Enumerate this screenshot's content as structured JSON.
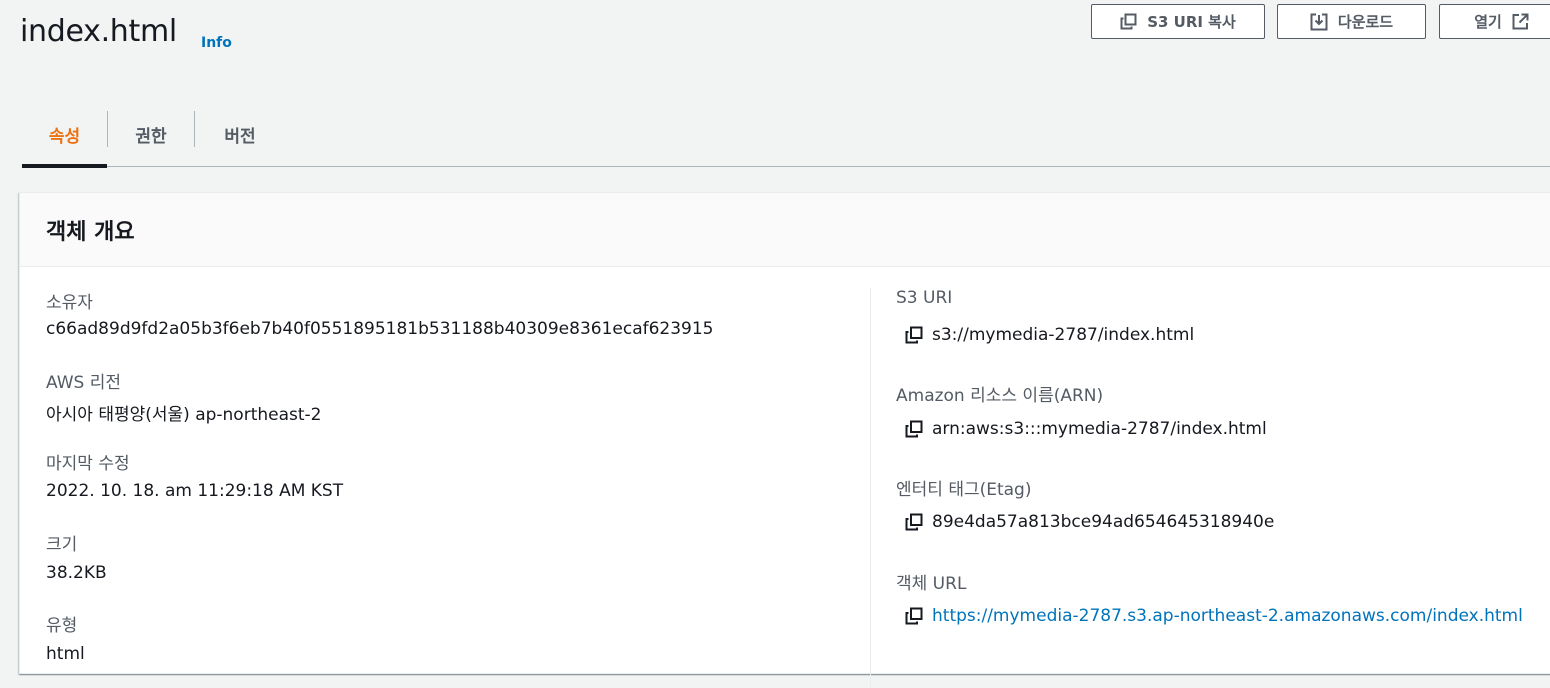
{
  "header": {
    "title": "index.html",
    "info_label": "Info",
    "buttons": {
      "copy_uri": "S3 URI 복사",
      "download": "다운로드",
      "open": "열기"
    }
  },
  "tabs": [
    {
      "label": "속성",
      "active": true
    },
    {
      "label": "권한",
      "active": false
    },
    {
      "label": "버전",
      "active": false
    }
  ],
  "overview": {
    "title": "객체 개요",
    "left": {
      "owner_label": "소유자",
      "owner_value": "c66ad89d9fd2a05b3f6eb7b40f0551895181b531188b40309e8361ecaf623915",
      "region_label": "AWS 리전",
      "region_value": "아시아 태평양(서울) ap-northeast-2",
      "modified_label": "마지막 수정",
      "modified_value": "2022. 10. 18. am 11:29:18 AM KST",
      "size_label": "크기",
      "size_value": "38.2KB",
      "type_label": "유형",
      "type_value": "html"
    },
    "right": {
      "s3uri_label": "S3 URI",
      "s3uri_value": "s3://mymedia-2787/index.html",
      "arn_label": "Amazon 리소스 이름(ARN)",
      "arn_value": "arn:aws:s3:::mymedia-2787/index.html",
      "etag_label": "엔터티 태그(Etag)",
      "etag_value": "89e4da57a813bce94ad654645318940e",
      "url_label": "객체 URL",
      "url_value": "https://mymedia-2787.s3.ap-northeast-2.amazonaws.com/index.html"
    }
  },
  "colors": {
    "accent_tab": "#ec7211",
    "link": "#0073bb",
    "text": "#16191f",
    "muted": "#545b64"
  }
}
